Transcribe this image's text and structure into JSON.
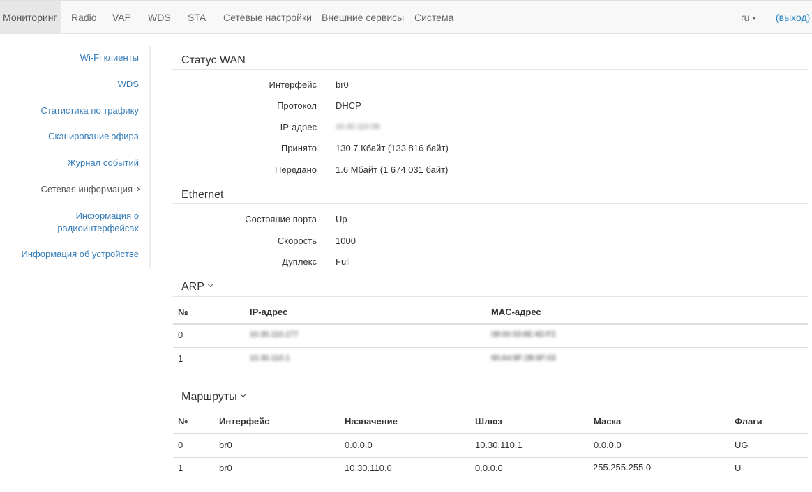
{
  "nav": {
    "items": [
      "Мониторинг",
      "Radio",
      "VAP",
      "WDS",
      "STA",
      "Сетевые настройки",
      "Внешние сервисы",
      "Система"
    ],
    "active": "Мониторинг",
    "lang": "ru",
    "logout": "(выход)"
  },
  "sidebar": {
    "items": [
      {
        "label": "Wi-Fi клиенты"
      },
      {
        "label": "WDS"
      },
      {
        "label": "Статистика по трафику"
      },
      {
        "label": "Сканирование эфира"
      },
      {
        "label": "Журнал событий"
      },
      {
        "label": "Сетевая информация"
      },
      {
        "label_line1": "Информация о",
        "label_line2": "радиоинтерфейсах"
      },
      {
        "label": "Информация об устройстве"
      }
    ]
  },
  "wan": {
    "title": "Статус WAN",
    "rows": [
      {
        "label": "Интерфейс",
        "value": "br0"
      },
      {
        "label": "Протокол",
        "value": "DHCP"
      },
      {
        "label": "IP-адрес",
        "value": "10.30.110.58"
      },
      {
        "label": "Принято",
        "value": "130.7 Кбайт (133 816 байт)"
      },
      {
        "label": "Передано",
        "value": "1.6 Мбайт (1 674 031 байт)"
      }
    ]
  },
  "ethernet": {
    "title": "Ethernet",
    "rows": [
      {
        "label": "Состояние порта",
        "value": "Up"
      },
      {
        "label": "Скорость",
        "value": "1000"
      },
      {
        "label": "Дуплекс",
        "value": "Full"
      }
    ]
  },
  "arp": {
    "title": "ARP",
    "headers": [
      "№",
      "IP-адрес",
      "MAC-адрес"
    ],
    "rows": [
      [
        "0",
        "10.30.110.177",
        "08:00:33:6E:4D:F2"
      ],
      [
        "1",
        "10.30.110.1",
        "90:A4:8F:2B:6F:03"
      ]
    ]
  },
  "routes": {
    "title": "Маршруты",
    "headers": [
      "№",
      "Интерфейс",
      "Назначение",
      "Шлюз",
      "Маска",
      "Флаги"
    ],
    "rows": [
      [
        "0",
        "br0",
        "0.0.0.0",
        "10.30.110.1",
        "0.0.0.0",
        "UG"
      ],
      [
        "1",
        "br0",
        "10.30.110.0",
        "0.0.0.0",
        "255.255.255.0",
        "U"
      ]
    ]
  }
}
